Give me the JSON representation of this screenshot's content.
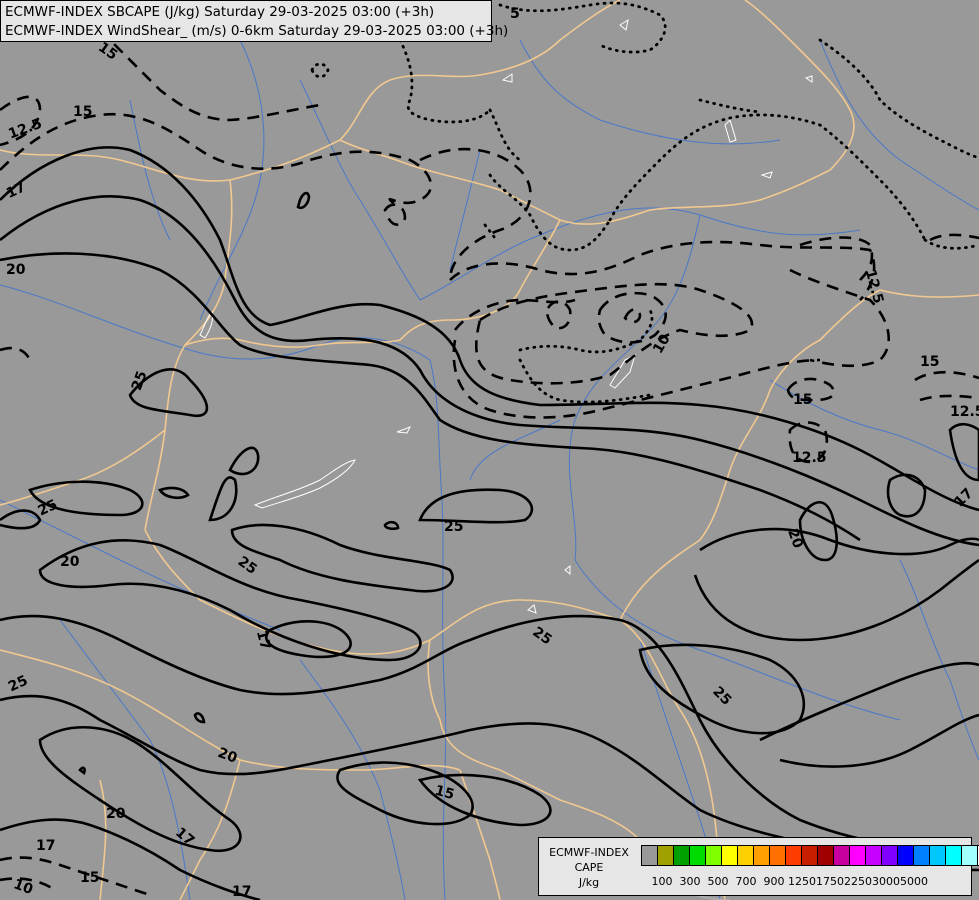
{
  "title": {
    "line1": "ECMWF-INDEX SBCAPE (J/kg) Saturday 29-03-2025 03:00 (+3h)",
    "line2": "ECMWF-INDEX WindShear_ (m/s) 0-6km Saturday 29-03-2025 03:00 (+3h)"
  },
  "legend": {
    "line1": "ECMWF-INDEX",
    "line2": "CAPE",
    "line3": "J/kg",
    "colors": [
      "#999999",
      "#a0a000",
      "#00a000",
      "#00dc00",
      "#80ff00",
      "#ffff00",
      "#ffd000",
      "#ffa000",
      "#ff7000",
      "#ff3c00",
      "#c81e00",
      "#a00000",
      "#c800a0",
      "#ff00ff",
      "#c800ff",
      "#8000ff",
      "#0000ff",
      "#0080ff",
      "#00c8ff",
      "#00ffff",
      "#a0ffff",
      "#ffffff"
    ],
    "ticks": [
      "100",
      "300",
      "500",
      "700",
      "900",
      "1250",
      "1750",
      "2250",
      "3000",
      "5000"
    ]
  },
  "contour_labels": [
    {
      "id": "l15a",
      "text": "15"
    },
    {
      "id": "l125a",
      "text": "12.5"
    },
    {
      "id": "l17a",
      "text": "17"
    },
    {
      "id": "l20a",
      "text": "20"
    },
    {
      "id": "l25a",
      "text": "25"
    },
    {
      "id": "l10",
      "text": "10"
    },
    {
      "id": "l125b",
      "text": "12.5"
    },
    {
      "id": "l15b",
      "text": "15"
    },
    {
      "id": "l125c",
      "text": "12.5"
    },
    {
      "id": "l15c",
      "text": "15"
    },
    {
      "id": "l125d",
      "text": "12.5"
    },
    {
      "id": "l17b",
      "text": "17"
    },
    {
      "id": "l20b",
      "text": "20"
    },
    {
      "id": "l25b",
      "text": "25"
    },
    {
      "id": "l25c",
      "text": "25"
    },
    {
      "id": "l20c",
      "text": "20"
    },
    {
      "id": "l25d",
      "text": "25"
    },
    {
      "id": "l17c",
      "text": "17"
    },
    {
      "id": "l25e",
      "text": "25"
    },
    {
      "id": "l25f",
      "text": "25"
    },
    {
      "id": "l25g",
      "text": "25"
    },
    {
      "id": "l20d",
      "text": "20"
    },
    {
      "id": "l15d",
      "text": "15"
    },
    {
      "id": "l20e",
      "text": "20"
    },
    {
      "id": "l17d",
      "text": "17"
    },
    {
      "id": "l17e",
      "text": "17"
    },
    {
      "id": "l15e",
      "text": "15"
    },
    {
      "id": "l10b",
      "text": "10"
    },
    {
      "id": "l17f",
      "text": "17"
    },
    {
      "id": "l5",
      "text": "5"
    },
    {
      "id": "l15f",
      "text": "15"
    }
  ]
}
